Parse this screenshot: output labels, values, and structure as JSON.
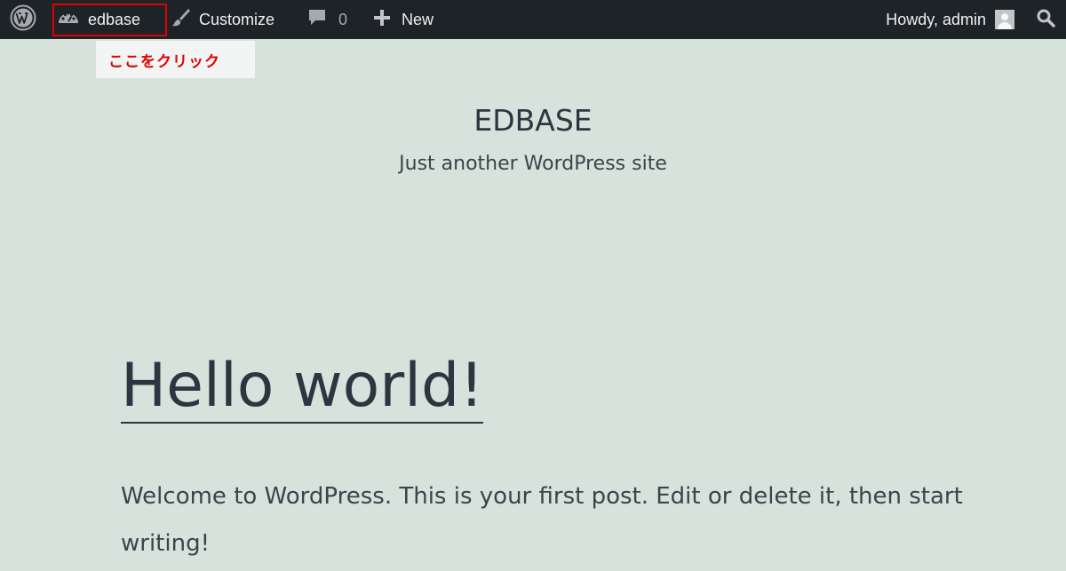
{
  "admin_bar": {
    "site_name": "edbase",
    "customize_label": "Customize",
    "comments_count": "0",
    "new_label": "New",
    "account_label": "Howdy, admin",
    "icons": {
      "wp_logo": "wordpress-logo-icon",
      "dashboard": "dashboard-gauge-icon",
      "customize": "paintbrush-icon",
      "comments": "speech-bubble-icon",
      "new": "plus-icon",
      "search": "search-icon"
    }
  },
  "annotation": {
    "callout_text": "ここをクリック",
    "highlight_color": "#e00000"
  },
  "site_header": {
    "title": "EDBASE",
    "tagline": "Just another WordPress site"
  },
  "post": {
    "title": "Hello world!",
    "body": "Welcome to WordPress. This is your first post. Edit or delete it, then start writing!"
  },
  "colors": {
    "admin_bar_bg": "#1d2327",
    "page_bg": "#d6e3dd",
    "text": "#2e3540"
  }
}
